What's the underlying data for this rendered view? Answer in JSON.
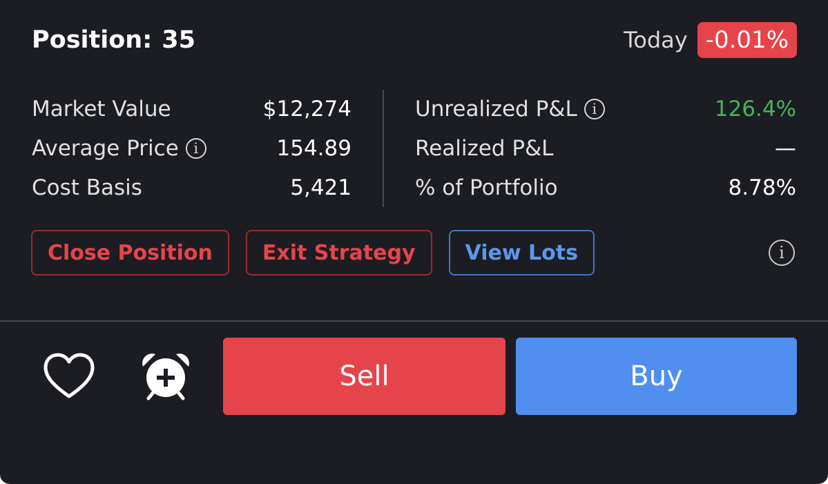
{
  "header": {
    "position_label": "Position:",
    "position_value": "35",
    "today_label": "Today",
    "today_change": "-0.01%"
  },
  "stats_left": [
    {
      "label": "Market Value",
      "value": "$12,274",
      "has_info": false
    },
    {
      "label": "Average Price",
      "value": "154.89",
      "has_info": true
    },
    {
      "label": "Cost Basis",
      "value": "5,421",
      "has_info": false
    }
  ],
  "stats_right": [
    {
      "label": "Unrealized P&L",
      "value": "126.4%",
      "has_info": true
    },
    {
      "label": "Realized P&L",
      "value": "—",
      "has_info": false
    },
    {
      "label": "% of Portfolio",
      "value": "8.78%",
      "has_info": false
    }
  ],
  "actions": {
    "close_position": "Close Position",
    "exit_strategy": "Exit Strategy",
    "view_lots": "View Lots",
    "info_icon": "info-icon"
  },
  "bottom": {
    "watchlist_icon": "heart-icon",
    "alert_icon": "alarm-add-icon",
    "sell_label": "Sell",
    "buy_label": "Buy"
  },
  "colors": {
    "background": "#1c1d22",
    "negative": "#e5444b",
    "positive": "#45b35f",
    "accent_blue": "#508ef0"
  }
}
